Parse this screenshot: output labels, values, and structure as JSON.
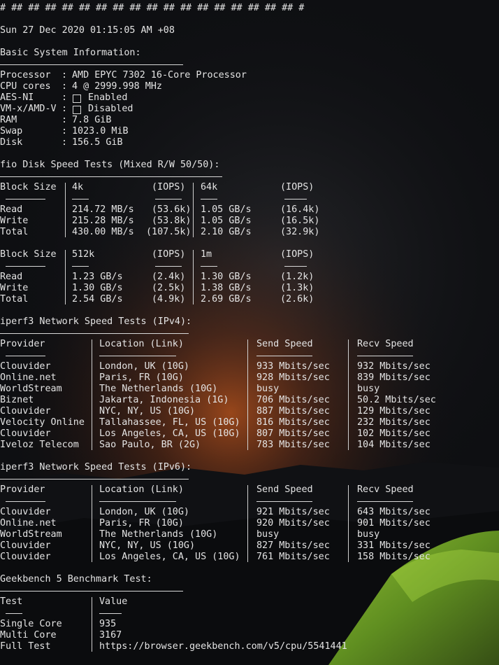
{
  "header_hashes": "# ## ## ## ## ## ## ## ## ## ## ## ## ## ## ## ## ## #",
  "datetime": "Sun 27 Dec 2020 01:15:05 AM +08",
  "sysinfo": {
    "title": "Basic System Information:",
    "rows": [
      {
        "label": "Processor",
        "value": "AMD EPYC 7302 16-Core Processor"
      },
      {
        "label": "CPU cores",
        "value": "4 @ 2999.998 MHz"
      },
      {
        "label": "AES-NI",
        "value": "Enabled",
        "checkbox": true
      },
      {
        "label": "VM-x/AMD-V",
        "value": "Disabled",
        "checkbox": true
      },
      {
        "label": "RAM",
        "value": "7.8 GiB"
      },
      {
        "label": "Swap",
        "value": "1023.0 MiB"
      },
      {
        "label": "Disk",
        "value": "156.5 GiB"
      }
    ]
  },
  "fio": {
    "title": "fio Disk Speed Tests (Mixed R/W 50/50):",
    "blocks": [
      {
        "header": [
          "Block Size",
          "4k",
          "(IOPS)",
          "64k",
          "(IOPS)"
        ],
        "dashes": [
          "------",
          "---",
          "----",
          "---",
          "----"
        ],
        "rows": [
          [
            "Read",
            "214.72 MB/s",
            "(53.6k)",
            "1.05 GB/s",
            "(16.4k)"
          ],
          [
            "Write",
            "215.28 MB/s",
            "(53.8k)",
            "1.05 GB/s",
            "(16.5k)"
          ],
          [
            "Total",
            "430.00 MB/s",
            "(107.5k)",
            "2.10 GB/s",
            "(32.9k)"
          ]
        ]
      },
      {
        "header": [
          "Block Size",
          "512k",
          "(IOPS)",
          "1m",
          "(IOPS)"
        ],
        "dashes": [
          "------",
          "---",
          "----",
          "---",
          "----"
        ],
        "rows": [
          [
            "Read",
            "1.23 GB/s",
            "(2.4k)",
            "1.30 GB/s",
            "(1.2k)"
          ],
          [
            "Write",
            "1.30 GB/s",
            "(2.5k)",
            "1.38 GB/s",
            "(1.3k)"
          ],
          [
            "Total",
            "2.54 GB/s",
            "(4.9k)",
            "2.69 GB/s",
            "(2.6k)"
          ]
        ]
      }
    ]
  },
  "iperf_ipv4": {
    "title": "iperf3 Network Speed Tests (IPv4):",
    "header": [
      "Provider",
      "Location (Link)",
      "Send Speed",
      "Recv Speed"
    ],
    "rows": [
      [
        "Clouvider",
        "London, UK (10G)",
        "933 Mbits/sec",
        "932 Mbits/sec"
      ],
      [
        "Online.net",
        "Paris, FR (10G)",
        "928 Mbits/sec",
        "839 Mbits/sec"
      ],
      [
        "WorldStream",
        "The Netherlands (10G)",
        "busy",
        "busy"
      ],
      [
        "Biznet",
        "Jakarta, Indonesia (1G)",
        "706 Mbits/sec",
        "50.2 Mbits/sec"
      ],
      [
        "Clouvider",
        "NYC, NY, US (10G)",
        "887 Mbits/sec",
        "129 Mbits/sec"
      ],
      [
        "Velocity Online",
        "Tallahassee, FL, US (10G)",
        "816 Mbits/sec",
        "232 Mbits/sec"
      ],
      [
        "Clouvider",
        "Los Angeles, CA, US (10G)",
        "807 Mbits/sec",
        "102 Mbits/sec"
      ],
      [
        "Iveloz Telecom",
        "Sao Paulo, BR (2G)",
        "783 Mbits/sec",
        "104 Mbits/sec"
      ]
    ]
  },
  "iperf_ipv6": {
    "title": "iperf3 Network Speed Tests (IPv6):",
    "header": [
      "Provider",
      "Location (Link)",
      "Send Speed",
      "Recv Speed"
    ],
    "rows": [
      [
        "Clouvider",
        "London, UK (10G)",
        "921 Mbits/sec",
        "643 Mbits/sec"
      ],
      [
        "Online.net",
        "Paris, FR (10G)",
        "920 Mbits/sec",
        "901 Mbits/sec"
      ],
      [
        "WorldStream",
        "The Netherlands (10G)",
        "busy",
        "busy"
      ],
      [
        "Clouvider",
        "NYC, NY, US (10G)",
        "827 Mbits/sec",
        "331 Mbits/sec"
      ],
      [
        "Clouvider",
        "Los Angeles, CA, US (10G)",
        "761 Mbits/sec",
        "158 Mbits/sec"
      ]
    ]
  },
  "geekbench": {
    "title": "Geekbench 5 Benchmark Test:",
    "header": [
      "Test",
      "Value"
    ],
    "rows": [
      [
        "Single Core",
        "935"
      ],
      [
        "Multi Core",
        "3167"
      ],
      [
        "Full Test",
        "https://browser.geekbench.com/v5/cpu/5541441"
      ]
    ]
  },
  "colors": {
    "text": "#e4e4e4",
    "background": "#0e0f12",
    "tent": "#7fb82a",
    "horizon": "#c4571c"
  }
}
